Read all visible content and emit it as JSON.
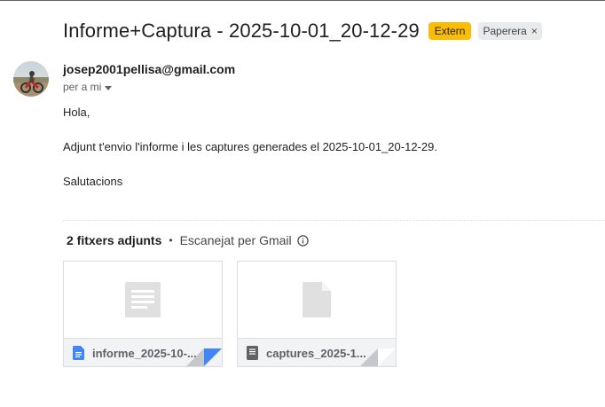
{
  "email": {
    "subject": "Informe+Captura - 2025-10-01_20-12-29",
    "labels": {
      "extern": "Extern",
      "trash": "Paperera",
      "remove_symbol": "×"
    },
    "sender": "josep2001pellisa@gmail.com",
    "to_text": "per a mi",
    "body": {
      "greeting": "Hola,",
      "message": "Adjunt t'envio l'informe i les captures generades el 2025-10-01_20-12-29.",
      "closing": "Salutacions"
    }
  },
  "attachments": {
    "count_label": "2 fitxers adjunts",
    "separator": "•",
    "scan_label": "Escanejat per Gmail",
    "files": [
      {
        "name": "informe_2025-10-...",
        "icon": "google-docs-icon",
        "icon_color": "#4285f4"
      },
      {
        "name": "captures_2025-1...",
        "icon": "text-file-icon",
        "icon_color": "#5f6368"
      }
    ]
  },
  "colors": {
    "extern_label": "#fbbc04",
    "trash_label": "#e8eaed",
    "doc_blue": "#4285f4"
  }
}
